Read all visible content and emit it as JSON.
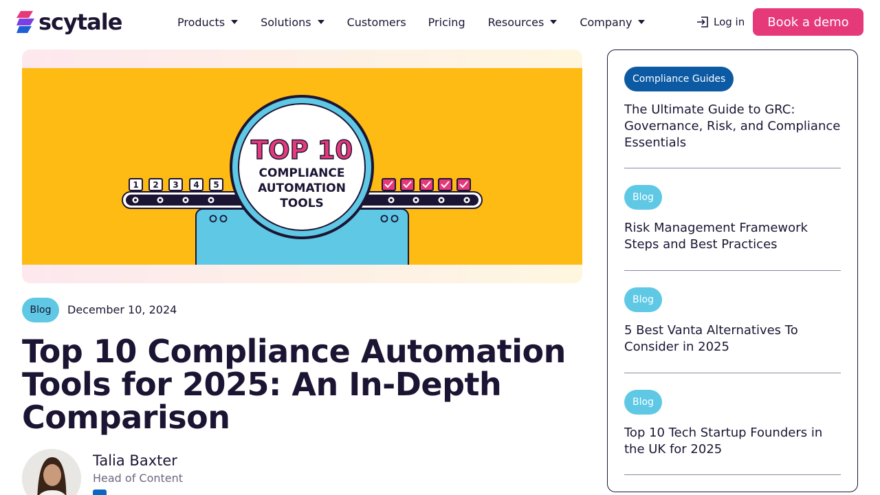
{
  "header": {
    "logo_text": "scytale",
    "nav": [
      {
        "label": "Products",
        "caret": true
      },
      {
        "label": "Solutions",
        "caret": true
      },
      {
        "label": "Customers",
        "caret": false
      },
      {
        "label": "Pricing",
        "caret": false
      },
      {
        "label": "Resources",
        "caret": true
      },
      {
        "label": "Company",
        "caret": true
      }
    ],
    "login_label": "Log in",
    "demo_label": "Book a demo"
  },
  "hero": {
    "headline_top": "TOP 10",
    "headline_lines": [
      "COMPLIANCE",
      "AUTOMATION",
      "TOOLS"
    ],
    "numbers": [
      "1",
      "2",
      "3",
      "4",
      "5"
    ],
    "checks": 5
  },
  "article": {
    "tag": "Blog",
    "date": "December 10, 2024",
    "title": "Top 10 Compliance Automation Tools for 2025: An In-Depth Comparison",
    "author_name": "Talia Baxter",
    "author_role": "Head of Content"
  },
  "sidebar": {
    "items": [
      {
        "tag": "Compliance Guides",
        "title": "The Ultimate Guide to GRC: Governance, Risk, and Compliance Essentials"
      },
      {
        "tag": "Blog",
        "title": "Risk Management Framework Steps and Best Practices"
      },
      {
        "tag": "Blog",
        "title": "5 Best Vanta Alternatives To Consider in 2025"
      },
      {
        "tag": "Blog",
        "title": "Top 10 Tech Startup Founders in the UK for 2025"
      }
    ]
  },
  "colors": {
    "brand_pink": "#e6397a",
    "hero_yellow": "#fdbb14",
    "tag_light_blue": "#5ec8e5",
    "tag_dark_blue": "#0b5aa3",
    "text_dark": "#1c1433"
  }
}
